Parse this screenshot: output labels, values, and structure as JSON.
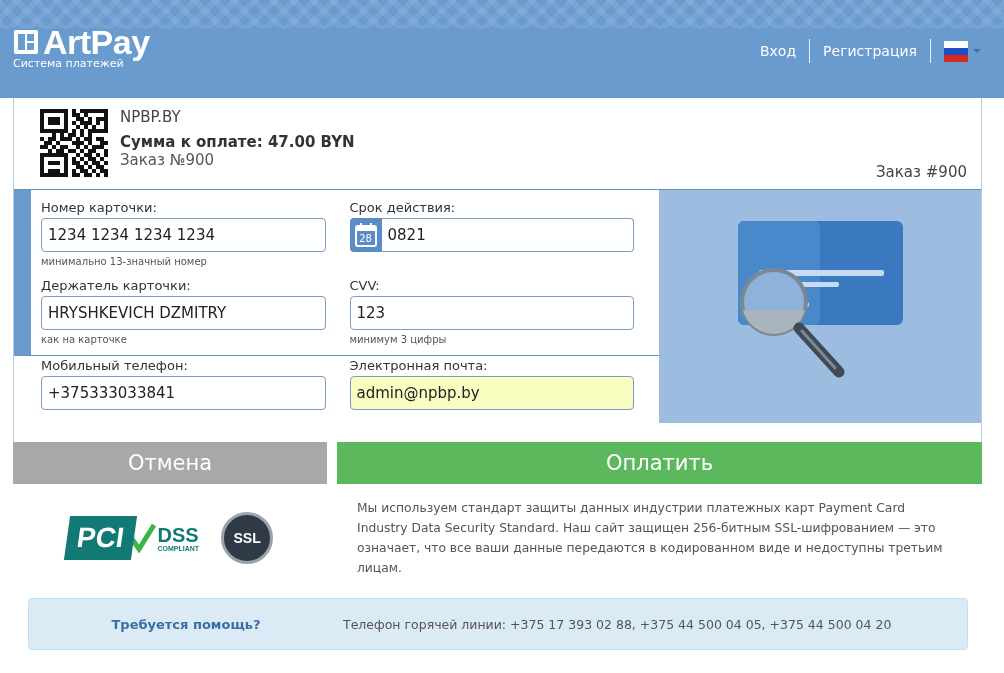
{
  "header": {
    "logo": {
      "name": "ArtPay",
      "tagline": "Система платежей"
    },
    "nav": [
      {
        "label": "Вход"
      },
      {
        "label": "Регистрация"
      }
    ],
    "language": {
      "kind": "flag-ru"
    }
  },
  "order": {
    "merchant": "NPBP.BY",
    "amount": "Сумма к оплате: 47.00 BYN",
    "order_label": "Заказ №900",
    "order_right": "Заказ #900"
  },
  "card_fields": [
    {
      "label": "Номер карточки:",
      "value": "1234 1234 1234 1234",
      "hint": "минимально 13-значный номер",
      "kind": "text",
      "autofilled": false
    },
    {
      "label": "Срок действия:",
      "value": "0821",
      "kind": "date",
      "calendar_day": "28",
      "autofilled": false
    },
    {
      "label": "Держатель карточки:",
      "value": "HRYSHKEVICH DZMITRY",
      "hint": "как на карточке",
      "kind": "text",
      "autofilled": false
    },
    {
      "label": "CVV:",
      "value": "123",
      "hint": "минимум 3 цифры",
      "kind": "text",
      "autofilled": false
    }
  ],
  "contact_fields": [
    {
      "label": "Мобильный телефон:",
      "value": "+375333033841",
      "autofilled": false
    },
    {
      "label": "Электронная почта:",
      "value": "admin@npbp.by",
      "autofilled": true
    }
  ],
  "buttons": [
    {
      "label": "Отмена",
      "kind": "cancel"
    },
    {
      "label": "Оплатить",
      "kind": "pay"
    }
  ],
  "security": {
    "pci_logo": {
      "mark": "PCI",
      "title": "DSS",
      "subtitle": "COMPLIANT"
    },
    "ssl_logo": {
      "label": "SSL"
    },
    "text": "Мы используем стандарт защиты данных индустрии платежных карт Payment Card Industry Data Security Standard. Наш сайт защищен 256-битным SSL-шифрованием — это означает, что все ваши данные передаются в кодированном виде и недоступны третьим лицам."
  },
  "help": {
    "title": "Требуется помощь?",
    "text": "Телефон горячей линии: +375 17 393 02 88, +375 44 500 04 05, +375 44 500 04 20"
  }
}
